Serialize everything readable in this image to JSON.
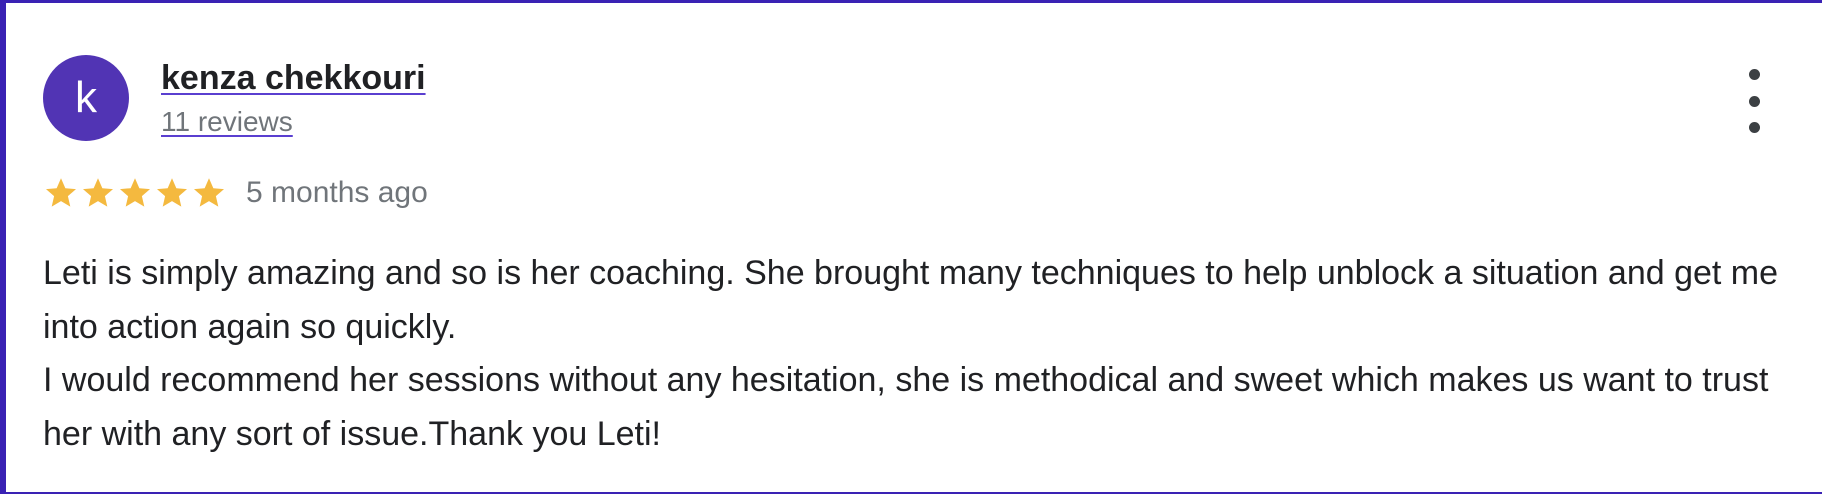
{
  "author": {
    "initial": "k",
    "name": "kenza chekkouri",
    "reviews_link": "11 reviews",
    "avatar_color": "#5134b4"
  },
  "menu": {
    "icon": "more-vert-icon"
  },
  "rating": {
    "stars": 5,
    "max": 5,
    "star_color": "#f4b93f",
    "date": "5 months ago"
  },
  "review": {
    "paragraph_1": "Leti is simply amazing and so is her coaching. She brought many techniques to help unblock a situation and get me into action again so quickly.",
    "paragraph_2": "I would recommend her sessions without any hesitation, she is methodical and sweet which makes us want to trust her with any sort of issue.Thank you Leti!"
  },
  "colors": {
    "frame_border": "#3a22b4",
    "link_underline": "#5a3fd0"
  }
}
